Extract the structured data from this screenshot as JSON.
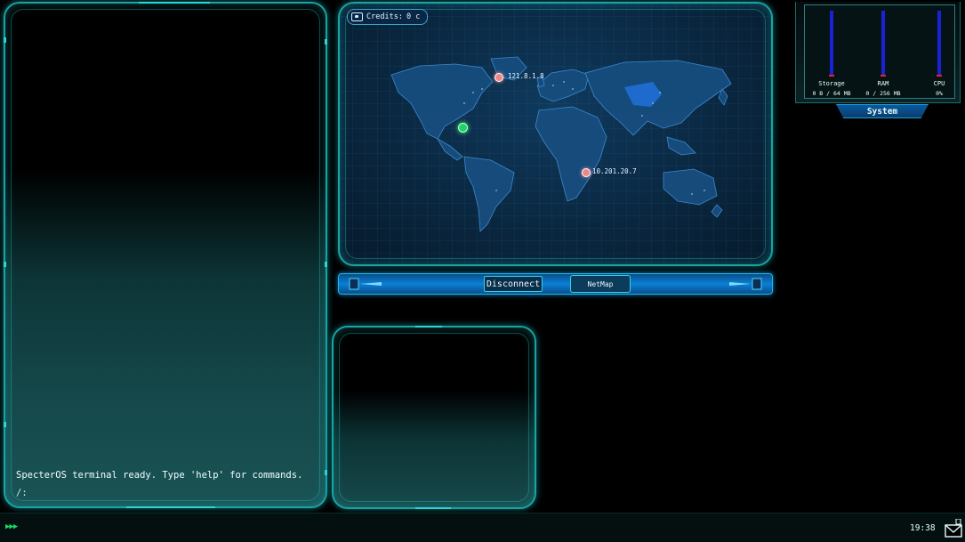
{
  "terminal": {
    "ready_message": "SpecterOS terminal ready. Type 'help' for commands.",
    "prompt": "/:"
  },
  "map": {
    "credits_label": "Credits:",
    "credits_value": "0 c",
    "credits_icon": "wallet-icon",
    "nodes": [
      {
        "ip": "121.8.1.8",
        "type": "remote"
      },
      {
        "ip": "10.201.20.7",
        "type": "remote"
      },
      {
        "ip": "",
        "type": "home"
      }
    ]
  },
  "toolbar": {
    "disconnect_label": "Disconnect",
    "netmap_label": "NetMap"
  },
  "system": {
    "title": "System",
    "meters": [
      {
        "label": "Storage",
        "value": "0 B / 64 MB",
        "fraction": 0.0
      },
      {
        "label": "RAM",
        "value": "0 / 256 MB",
        "fraction": 0.0
      },
      {
        "label": "CPU",
        "value": "0%",
        "fraction": 0.0
      }
    ]
  },
  "taskbar": {
    "start_icon": "triple-chevron-icon",
    "clock": "19:38",
    "mail_icon": "mail-icon"
  },
  "colors": {
    "panel_border": "#1aa3a3",
    "meter_empty": "#1a22d8",
    "meter_fill": "#e82424",
    "accent_green": "#1fd36a"
  }
}
